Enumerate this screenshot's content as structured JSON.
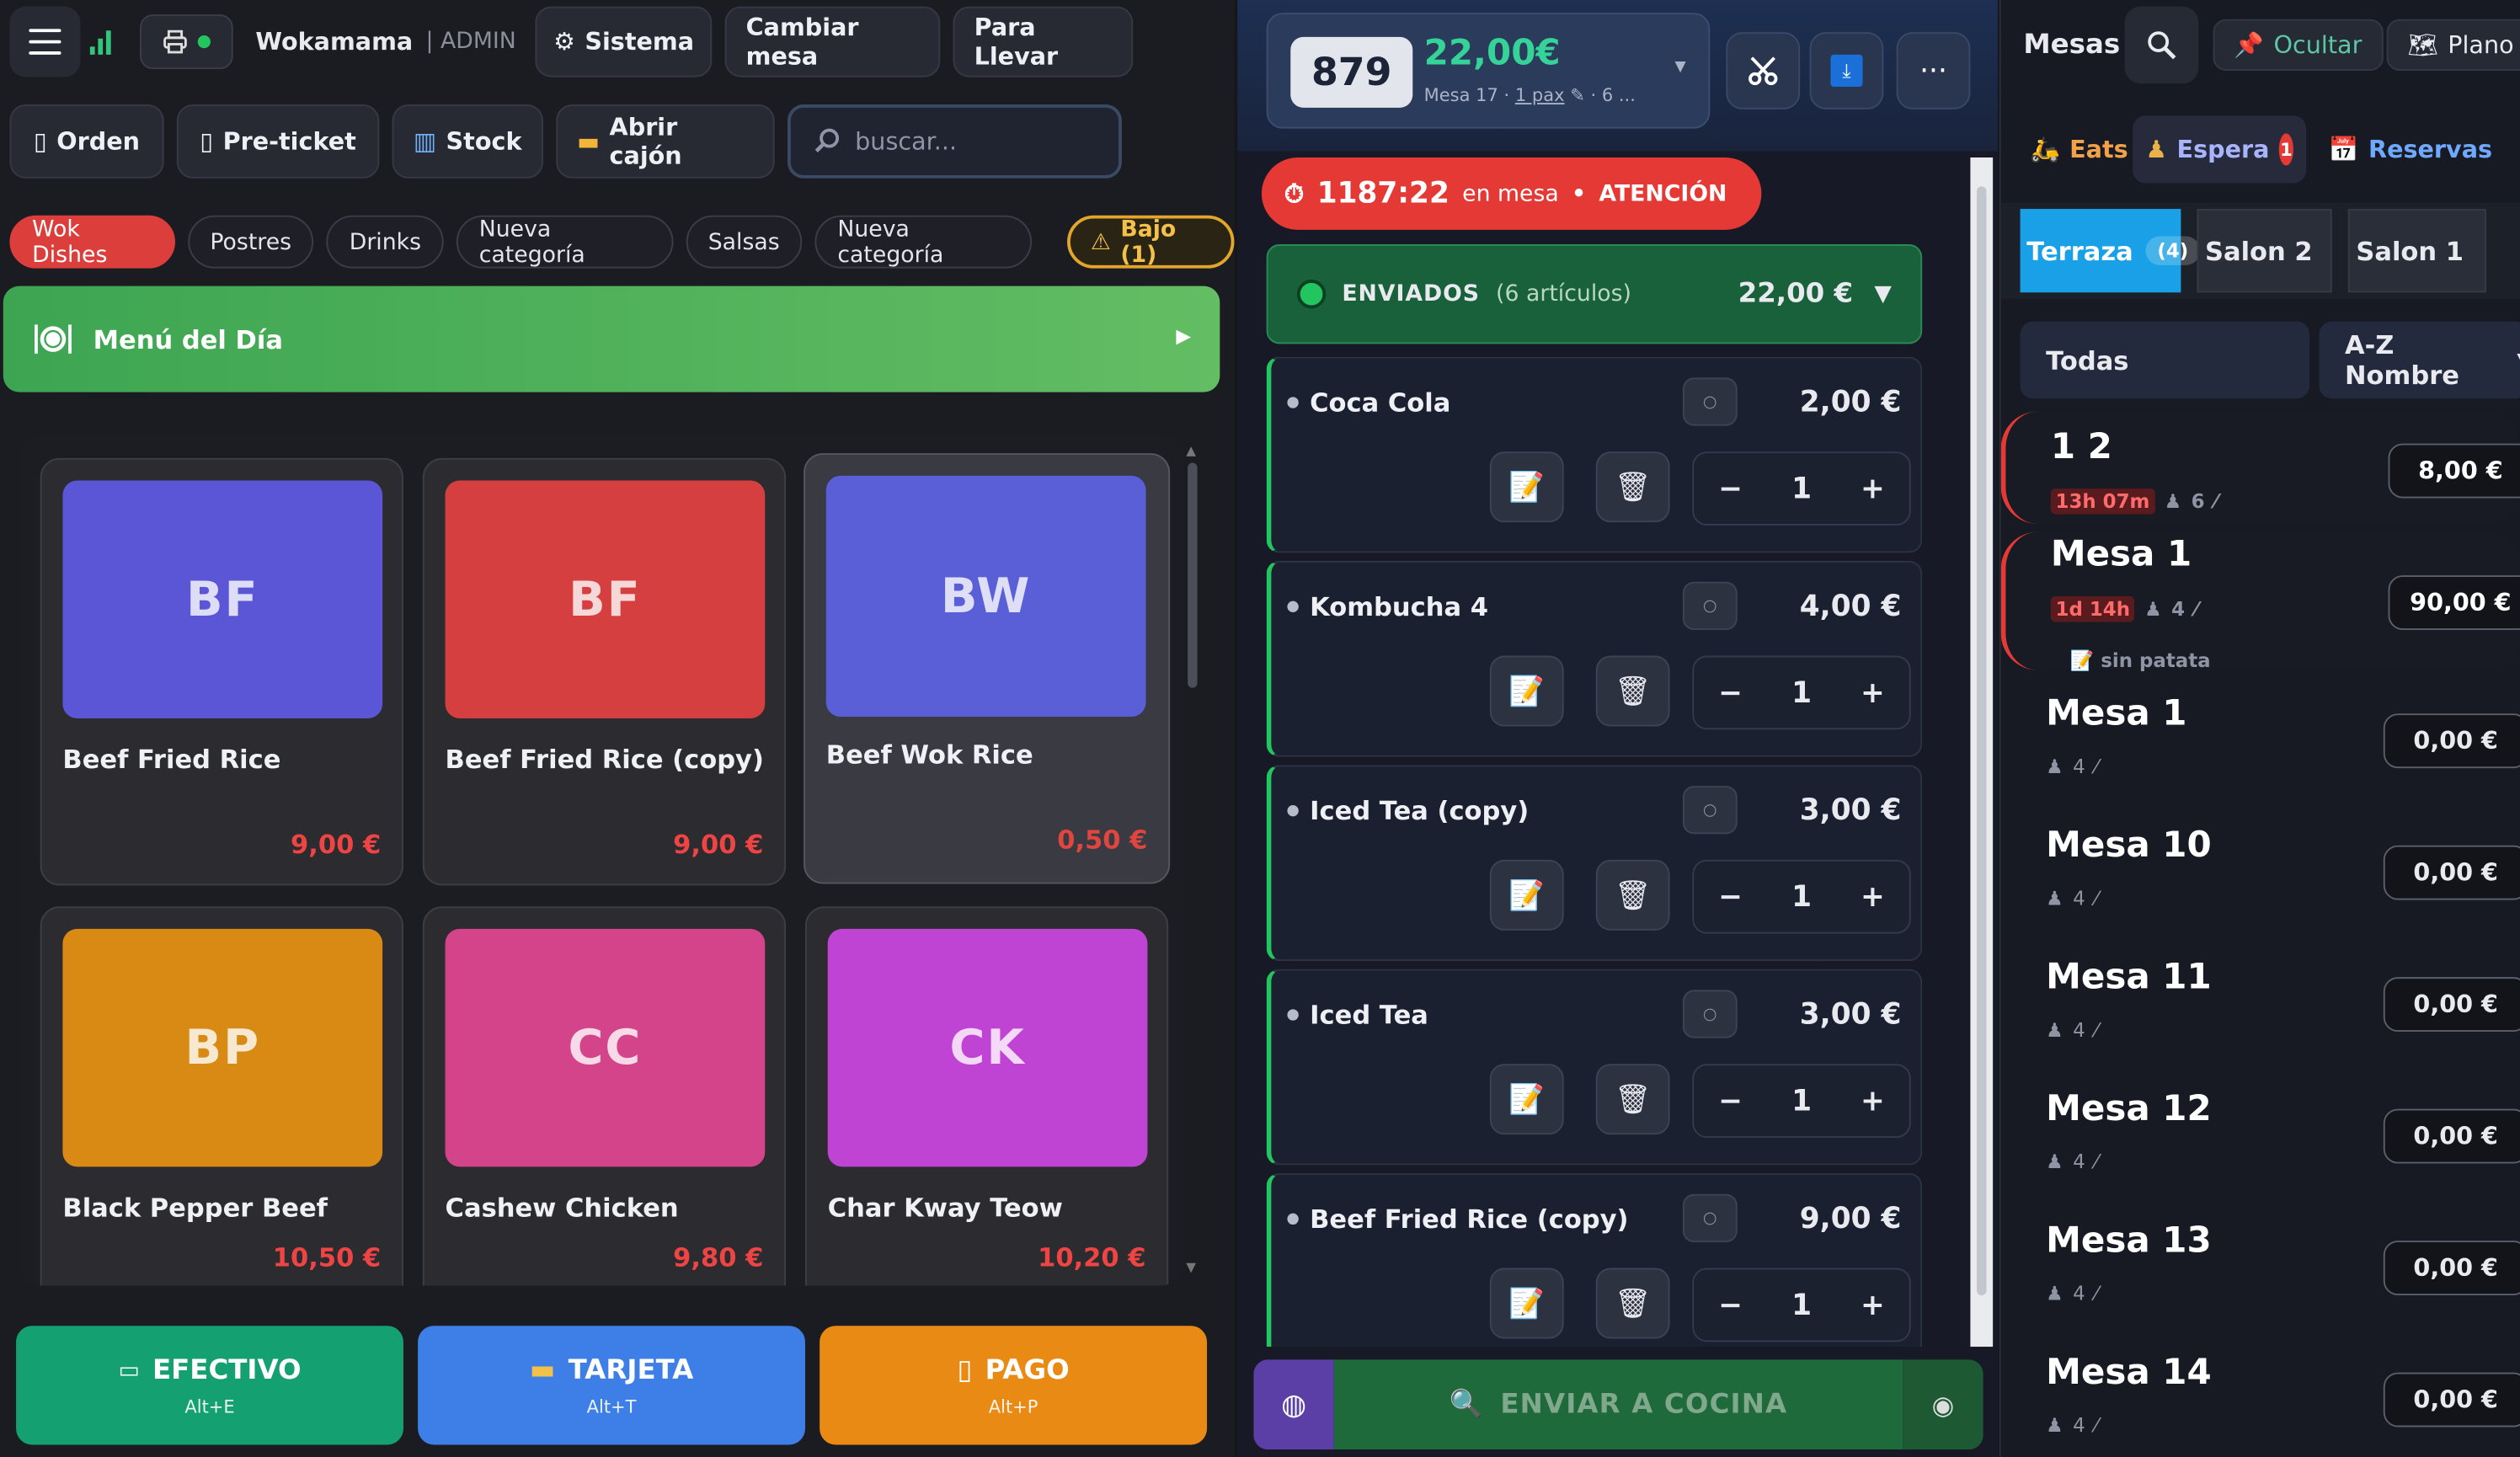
{
  "header": {
    "app_name": "Wokamama",
    "role": "| ADMIN",
    "sistema": "Sistema",
    "cambiar_mesa": "Cambiar mesa",
    "para_llevar": "Para Llevar"
  },
  "toolbar": {
    "orden": "Orden",
    "preticket": "Pre-ticket",
    "stock": "Stock",
    "abrir_cajon": "Abrir cajón",
    "search_placeholder": "buscar..."
  },
  "categories": [
    "Wok Dishes",
    "Postres",
    "Drinks",
    "Nueva categoría",
    "Salsas",
    "Nueva categoría"
  ],
  "low_stock": "Bajo (1)",
  "menu_del_dia": "Menú del Día",
  "products": [
    {
      "initials": "BF",
      "name": "Beef Fried Rice",
      "price": "9,00 €",
      "color": "#5a56d6"
    },
    {
      "initials": "BF",
      "name": "Beef Fried Rice (copy)",
      "price": "9,00 €",
      "color": "#d63f3f"
    },
    {
      "initials": "BW",
      "name": "Beef Wok Rice",
      "price": "0,50 €",
      "color": "#5a5fd8"
    },
    {
      "initials": "BP",
      "name": "Black Pepper Beef",
      "price": "10,50 €",
      "color": "#d88a14"
    },
    {
      "initials": "CC",
      "name": "Cashew Chicken",
      "price": "9,80 €",
      "color": "#d4448a"
    },
    {
      "initials": "CK",
      "name": "Char Kway Teow",
      "price": "10,20 €",
      "color": "#c044d4"
    }
  ],
  "payments": {
    "cash": "EFECTIVO",
    "cash_key": "Alt+E",
    "card": "TARJETA",
    "card_key": "Alt+T",
    "pago": "PAGO",
    "pago_key": "Alt+P",
    "cash_color": "#14a070",
    "card_color": "#3d7fe6",
    "pago_color": "#e98a14"
  },
  "ticket": {
    "number": "879",
    "total": "22,00€",
    "mesa": "Mesa 17",
    "pax": "1 pax",
    "more": "6 ..."
  },
  "alert": {
    "time": "1187:22",
    "label": "en mesa",
    "status": "ATENCIÓN"
  },
  "sent": {
    "label": "ENVIADOS",
    "count": "(6 artículos)",
    "total": "22,00 €"
  },
  "order_items": [
    {
      "name": "Coca Cola",
      "price": "2,00 €",
      "qty": "1"
    },
    {
      "name": "Kombucha 4",
      "price": "4,00 €",
      "qty": "1"
    },
    {
      "name": "Iced Tea (copy)",
      "price": "3,00 €",
      "qty": "1"
    },
    {
      "name": "Iced Tea",
      "price": "3,00 €",
      "qty": "1"
    },
    {
      "name": "Beef Fried Rice (copy)",
      "price": "9,00 €",
      "qty": "1"
    }
  ],
  "send_kitchen": "ENVIAR A COCINA",
  "right": {
    "title": "Mesas",
    "ocultar": "Ocultar",
    "plano": "Plano",
    "eats": "Eats",
    "espera": "Espera",
    "espera_badge": "1",
    "reservas": "Reservas",
    "filter": "Todas",
    "sort": "A-Z Nombre"
  },
  "zones": [
    {
      "name": "Terraza",
      "count": "(4)"
    },
    {
      "name": "Salon 2"
    },
    {
      "name": "Salon 1"
    }
  ],
  "tables": [
    {
      "name": "1 2",
      "time": "13h 07m",
      "pax": "6",
      "amount": "8,00 €"
    },
    {
      "name": "Mesa 1",
      "time": "1d 14h",
      "pax": "4",
      "amount": "90,00 €",
      "note": "sin patata"
    },
    {
      "name": "Mesa 1",
      "pax": "4",
      "amount": "0,00 €"
    },
    {
      "name": "Mesa 10",
      "pax": "4",
      "amount": "0,00 €"
    },
    {
      "name": "Mesa 11",
      "pax": "4",
      "amount": "0,00 €"
    },
    {
      "name": "Mesa 12",
      "pax": "4",
      "amount": "0,00 €"
    },
    {
      "name": "Mesa 13",
      "pax": "4",
      "amount": "0,00 €"
    },
    {
      "name": "Mesa 14",
      "pax": "4",
      "amount": "0,00 €"
    }
  ]
}
